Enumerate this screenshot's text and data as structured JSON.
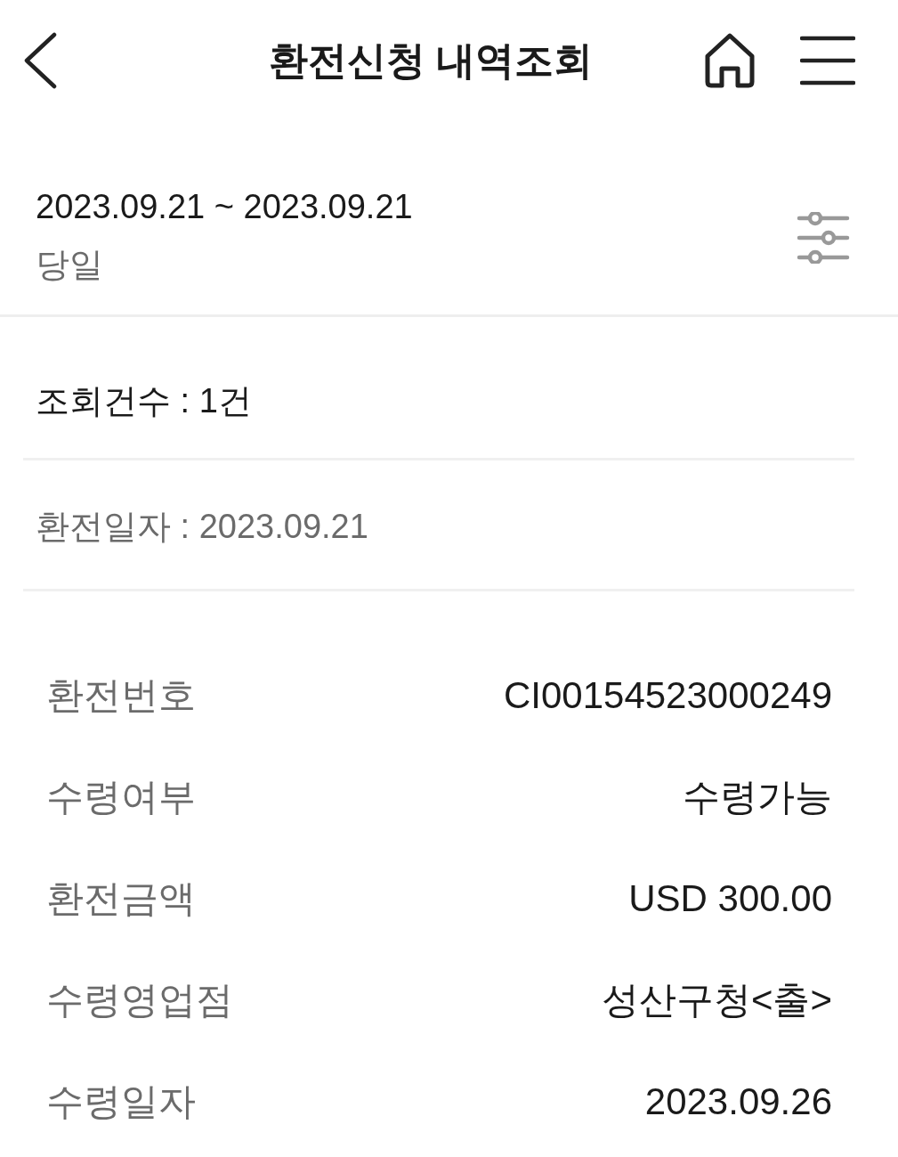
{
  "header": {
    "title": "환전신청 내역조회"
  },
  "period": {
    "range": "2023.09.21 ~ 2023.09.21",
    "label": "당일"
  },
  "count": {
    "text": "조회건수 : 1건"
  },
  "group": {
    "date": "환전일자 : 2023.09.21"
  },
  "details": [
    {
      "label": "환전번호",
      "value": "CI00154523000249"
    },
    {
      "label": "수령여부",
      "value": "수령가능"
    },
    {
      "label": "환전금액",
      "value": "USD 300.00"
    },
    {
      "label": "수령영업점",
      "value": "성산구청<출>"
    },
    {
      "label": "수령일자",
      "value": "2023.09.26"
    }
  ]
}
